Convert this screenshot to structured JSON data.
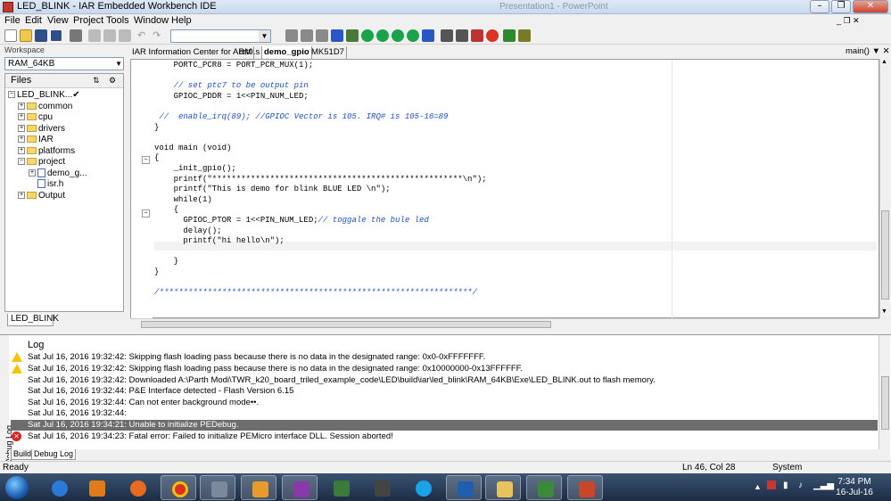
{
  "window": {
    "title": "LED_BLINK - IAR Embedded Workbench IDE",
    "background_title": "Presentation1 - PowerPoint"
  },
  "menu": [
    "File",
    "Edit",
    "View",
    "Project",
    "Tools",
    "Window",
    "Help"
  ],
  "workspace": {
    "label": "Workspace",
    "config": "RAM_64KB",
    "files_header": "Files",
    "project": "LED_BLINK...",
    "tree": [
      {
        "label": "common",
        "type": "folder"
      },
      {
        "label": "cpu",
        "type": "folder"
      },
      {
        "label": "drivers",
        "type": "folder"
      },
      {
        "label": "IAR",
        "type": "folder"
      },
      {
        "label": "platforms",
        "type": "folder"
      },
      {
        "label": "project",
        "type": "folder"
      },
      {
        "label": "demo_g...",
        "type": "file"
      },
      {
        "label": "isr.h",
        "type": "file"
      },
      {
        "label": "Output",
        "type": "folder"
      }
    ],
    "tab": "LED_BLINK"
  },
  "editor": {
    "tabs": [
      "IAR Information Center for ARM",
      "crt0.s",
      "demo_gpio",
      "MK51D7"
    ],
    "active_tab": "demo_gpio",
    "function_dropdown": "main()",
    "lines": [
      {
        "text": "    PORTC_PCR8 = PORT_PCR_MUX(1);",
        "type": "code"
      },
      {
        "text": "",
        "type": "code"
      },
      {
        "text": "    // set ptc7 to be output pin",
        "type": "comment"
      },
      {
        "text": "    GPIOC_PDDR = 1<<PIN_NUM_LED;",
        "type": "code"
      },
      {
        "text": "",
        "type": "code"
      },
      {
        "text": " //  enable_irq(89); //GPIOC Vector is 105. IRQ# is 105-16=89",
        "type": "comment"
      },
      {
        "text": "}",
        "type": "code"
      },
      {
        "text": "",
        "type": "code"
      },
      {
        "text": "void main (void)",
        "type": "code"
      },
      {
        "text": "{",
        "type": "code"
      },
      {
        "text": "    _init_gpio();",
        "type": "code"
      },
      {
        "text": "    printf(\"****************************************************\\n\");",
        "type": "code"
      },
      {
        "text": "    printf(\"This is demo for blink BLUE LED \\n\");",
        "type": "code"
      },
      {
        "text": "    while(1)",
        "type": "code"
      },
      {
        "text": "    {",
        "type": "code"
      },
      {
        "text": "      GPIOC_PTOR = 1<<PIN_NUM_LED;",
        "type": "code",
        "comment": "// toggale the bule led"
      },
      {
        "text": "      delay();",
        "type": "code"
      },
      {
        "text": "      printf(\"hi hello\\n\");",
        "type": "code"
      },
      {
        "text": "",
        "type": "code"
      },
      {
        "text": "    }",
        "type": "code"
      },
      {
        "text": "}",
        "type": "code"
      },
      {
        "text": "",
        "type": "code"
      },
      {
        "text": "/*****************************************************************/",
        "type": "comment"
      }
    ]
  },
  "log": {
    "header": "Log",
    "side_label": "Debug Log",
    "entries": [
      {
        "icon": "warning",
        "text": "Sat Jul 16, 2016 19:32:42: Skipping flash loading pass because there is no data in the designated range: 0x0-0xFFFFFFF."
      },
      {
        "icon": "warning",
        "text": "Sat Jul 16, 2016 19:32:42: Skipping flash loading pass because there is no data in the designated range: 0x10000000-0x13FFFFFF."
      },
      {
        "icon": "none",
        "text": "Sat Jul 16, 2016 19:32:42: Downloaded A:\\Parth Modi\\TWR_k20_board_triled_example_code\\LED\\build\\iar\\led_blink\\RAM_64KB\\Exe\\LED_BLINK.out to flash memory."
      },
      {
        "icon": "none",
        "text": "Sat Jul 16, 2016 19:32:44: P&E Interface detected - Flash Version 6.15"
      },
      {
        "icon": "none",
        "text": "Sat Jul 16, 2016 19:32:44: Can not enter background mode••."
      },
      {
        "icon": "none",
        "text": "Sat Jul 16, 2016 19:32:44:"
      },
      {
        "icon": "none",
        "text": "Sat Jul 16, 2016 19:34:21: Unable to initialize PEDebug."
      },
      {
        "icon": "error",
        "text": "Sat Jul 16, 2016 19:34:23: Fatal error: Failed to initialize PEMicro interface DLL.  Session aborted!"
      }
    ],
    "tabs": [
      "Build",
      "Debug Log"
    ],
    "active_tab": "Debug Log"
  },
  "status": {
    "left": "Ready",
    "position": "Ln 46, Col 28",
    "mode": "System"
  },
  "taskbar": {
    "time": "7:34 PM",
    "date": "16-Jul-16"
  },
  "colors": {
    "comment": "#1f4fc8",
    "selection": "#3264c8",
    "log_selected": "#6d6d6d"
  }
}
